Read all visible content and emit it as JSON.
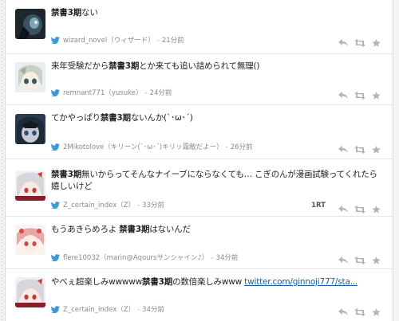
{
  "tweets": [
    {
      "pre": "",
      "bold": "禁書3期",
      "post": "ない",
      "username": "wizard_novel",
      "display": "（ウィザード）",
      "time": "21分前"
    },
    {
      "pre": "来年受験だから",
      "bold": "禁書3期",
      "post": "とか来ても追い詰められて無理()",
      "username": "remnant771",
      "display": "（yusuke）",
      "time": "24分前"
    },
    {
      "pre": "てかやっぱり",
      "bold": "禁書3期",
      "post": "ないんか(`･ω･´)",
      "username": "2Mikotolove",
      "display": "（キリーン(`･ω･´)キリッ霧敵だよー）",
      "time": "26分前"
    },
    {
      "pre": "",
      "bold": "禁書3期",
      "post": "無いからってそんなナイーブにならなくても… こぎのんが漫画試験ってくれたら嬉しいけど",
      "username": "Z_certain_index",
      "display": "（Z）",
      "time": "33分前",
      "rt": "1RT"
    },
    {
      "pre": "もうあきらめろよ ",
      "bold": "禁書3期",
      "post": "はないんだ",
      "username": "flere10032",
      "display": "（marin@Aqoursサンシャイン♪）",
      "time": "34分前"
    },
    {
      "pre": "やべぇ超楽しみwwwww",
      "bold": "禁書3期",
      "post": "の数倍楽しみwww ",
      "link": "twitter.com/ginnoji777/sta...",
      "username": "Z_certain_index",
      "display": "（Z）",
      "time": "34分前"
    }
  ]
}
